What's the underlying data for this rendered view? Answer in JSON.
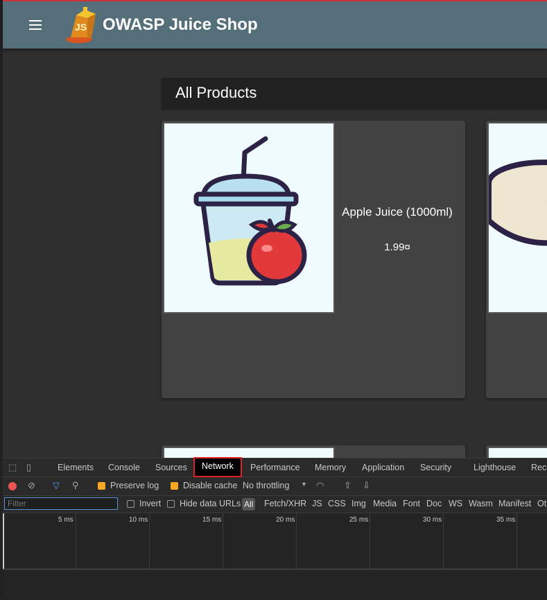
{
  "app": {
    "title": "OWASP Juice Shop"
  },
  "main": {
    "heading": "All Products",
    "products": [
      {
        "name": "Apple Juice (1000ml)",
        "price": "1.99¤"
      }
    ]
  },
  "devtools": {
    "tabs": [
      "Elements",
      "Console",
      "Sources",
      "Network",
      "Performance",
      "Memory",
      "Application",
      "Security",
      "Lighthouse",
      "Rec"
    ],
    "active_tab": "Network",
    "toolbar": {
      "preserve_log": "Preserve log",
      "disable_cache": "Disable cache",
      "throttling": "No throttling"
    },
    "filter": {
      "placeholder": "Filter",
      "invert": "Invert",
      "hide_data_urls": "Hide data URLs",
      "types": [
        "All",
        "Fetch/XHR",
        "JS",
        "CSS",
        "Img",
        "Media",
        "Font",
        "Doc",
        "WS",
        "Wasm",
        "Manifest",
        "Ot"
      ]
    },
    "timeline_ticks": [
      "5 ms",
      "10 ms",
      "15 ms",
      "20 ms",
      "25 ms",
      "30 ms",
      "35 ms"
    ]
  },
  "colors": {
    "toolbar": "#546e7a",
    "background": "#2f2f2f",
    "card": "#424242",
    "highlight": "#dd2222",
    "checkbox": "#f5a623"
  }
}
